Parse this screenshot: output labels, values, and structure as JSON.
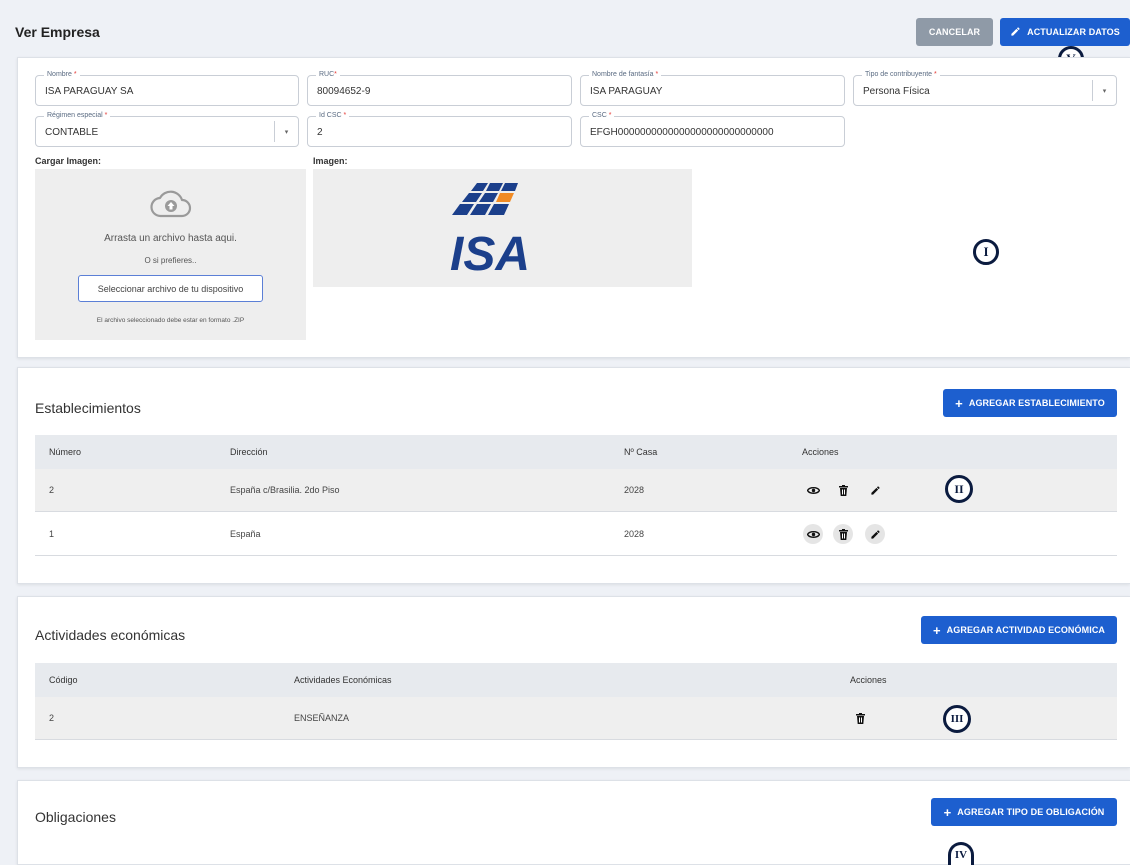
{
  "header": {
    "title": "Ver Empresa",
    "cancel_label": "CANCELAR",
    "update_label": "ACTUALIZAR DATOS"
  },
  "form": {
    "nombre": {
      "label": "Nombre",
      "value": "ISA PARAGUAY SA"
    },
    "ruc": {
      "label": "RUC",
      "value": "80094652-9"
    },
    "fantasia": {
      "label": "Nombre de fantasía",
      "value": "ISA PARAGUAY"
    },
    "tipo": {
      "label": "Tipo de contribuyente",
      "value": "Persona Física"
    },
    "regimen": {
      "label": "Régimen especial",
      "value": "CONTABLE"
    },
    "idcsc": {
      "label": "Id CSC",
      "value": "2"
    },
    "csc": {
      "label": "CSC",
      "value": "EFGH0000000000000000000000000000"
    },
    "required_mark": "*"
  },
  "upload": {
    "label": "Cargar Imagen:",
    "drag_text": "Arrasta un archivo hasta aqui.",
    "or_text": "O si prefieres..",
    "button_label": "Seleccionar archivo de tu dispositivo",
    "format_note": "El archivo seleccionado debe estar en formato .ZIP"
  },
  "image": {
    "label": "Imagen:",
    "logo_text": "ISA"
  },
  "establecimientos": {
    "title": "Establecimientos",
    "add_label": "AGREGAR ESTABLECIMIENTO",
    "columns": [
      "Número",
      "Dirección",
      "Nº Casa",
      "Acciones"
    ],
    "rows": [
      {
        "numero": "2",
        "direccion": "España c/Brasilia. 2do Piso",
        "casa": "2028"
      },
      {
        "numero": "1",
        "direccion": "España",
        "casa": "2028"
      }
    ]
  },
  "actividades": {
    "title": "Actividades económicas",
    "add_label": "AGREGAR ACTIVIDAD ECONÓMICA",
    "columns": [
      "Código",
      "Actividades Económicas",
      "Acciones"
    ],
    "rows": [
      {
        "codigo": "2",
        "actividad": "ENSEÑANZA"
      }
    ]
  },
  "obligaciones": {
    "title": "Obligaciones",
    "add_label": "AGREGAR TIPO DE OBLIGACIÓN"
  },
  "markers": [
    "I",
    "II",
    "III",
    "IV",
    "V"
  ],
  "colors": {
    "primary": "#1d5fcf",
    "secondary": "#8f9aa7",
    "marker": "#0b1b3f",
    "logo_blue": "#1b3f8b",
    "logo_orange": "#f08a24"
  }
}
